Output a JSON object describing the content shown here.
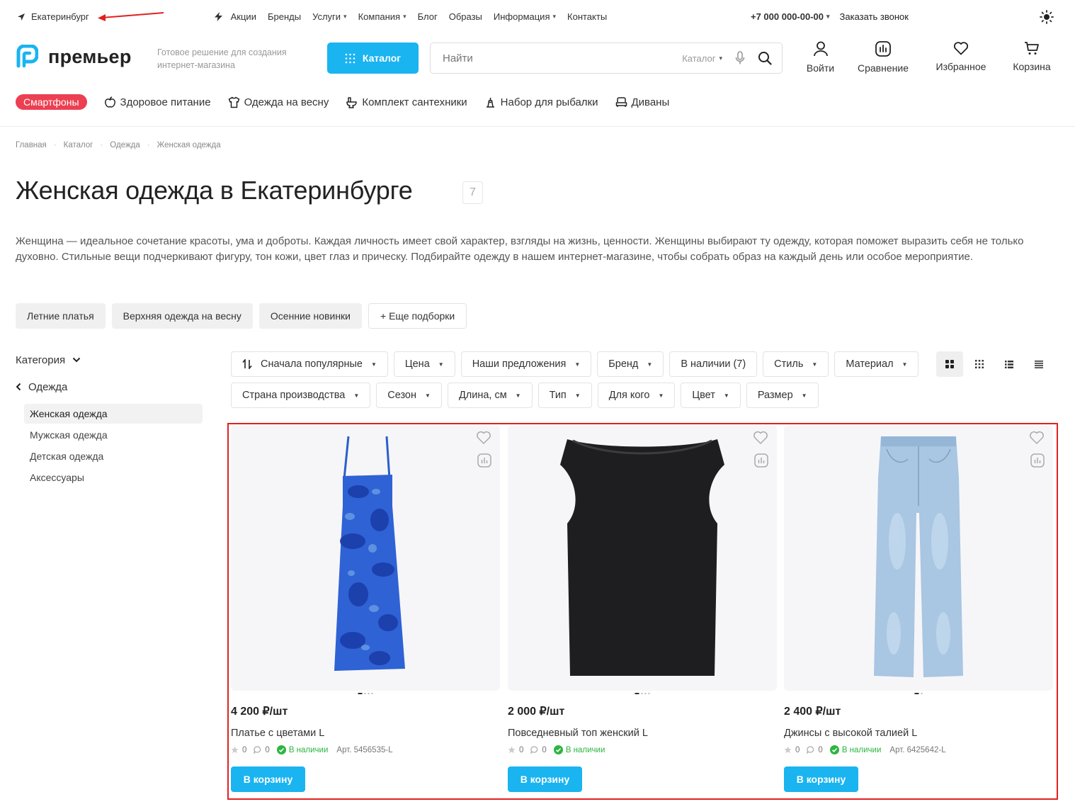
{
  "topbar": {
    "city": "Екатеринбург",
    "nav": [
      "Акции",
      "Бренды",
      "Услуги",
      "Компания",
      "Блог",
      "Образы",
      "Информация",
      "Контакты"
    ],
    "nav_dropdowns": [
      false,
      false,
      true,
      true,
      false,
      false,
      true,
      false
    ],
    "phone": "+7 000 000-00-00",
    "callback": "Заказать звонок"
  },
  "header": {
    "logo": "премьер",
    "slogan": "Готовое решение для создания интернет-магазина",
    "catalog_button": "Каталог",
    "search_placeholder": "Найти",
    "search_scope": "Каталог",
    "icons": [
      {
        "name": "login",
        "label": "Войти"
      },
      {
        "name": "compare",
        "label": "Сравнение"
      },
      {
        "name": "favorites",
        "label": "Избранное"
      },
      {
        "name": "cart",
        "label": "Корзина"
      }
    ]
  },
  "quick_links": {
    "badge": "Смартфоны",
    "items": [
      "Здоровое питание",
      "Одежда на весну",
      "Комплект сантехники",
      "Набор для рыбалки",
      "Диваны"
    ]
  },
  "breadcrumbs": [
    "Главная",
    "Каталог",
    "Одежда",
    "Женская одежда"
  ],
  "page": {
    "title": "Женская одежда в Екатеринбурге",
    "count": "7",
    "description": "Женщина — идеальное сочетание красоты, ума и доброты. Каждая личность имеет свой характер, взгляды на жизнь, ценности. Женщины выбирают ту одежду, которая поможет выразить себя не только духовно. Стильные вещи подчеркивают фигуру, тон кожи, цвет глаз и прическу. Подбирайте одежду в нашем интернет-магазине, чтобы собрать образ на каждый день или особое мероприятие."
  },
  "collections": [
    "Летние платья",
    "Верхняя одежда на весну",
    "Осенние новинки",
    "+ Еще подборки"
  ],
  "sidebar": {
    "heading": "Категория",
    "parent": "Одежда",
    "items": [
      "Женская одежда",
      "Мужская одежда",
      "Детская одежда",
      "Аксессуары"
    ],
    "active": 0
  },
  "filters": {
    "sort": "Сначала популярные",
    "items": [
      "Цена",
      "Наши предложения",
      "Бренд",
      "В наличии (7)",
      "Стиль",
      "Материал",
      "Страна производства",
      "Сезон",
      "Длина, см",
      "Тип",
      "Для кого",
      "Цвет",
      "Размер"
    ]
  },
  "products": [
    {
      "price": "4 200 ₽/шт",
      "name": "Платье с цветами L",
      "rating": "0",
      "reviews": "0",
      "stock": "В наличии",
      "sku": "Арт. 5456535-L",
      "button": "В корзину"
    },
    {
      "price": "2 000 ₽/шт",
      "name": "Повседневный топ женский L",
      "rating": "0",
      "reviews": "0",
      "stock": "В наличии",
      "sku": "",
      "button": "В корзину"
    },
    {
      "price": "2 400 ₽/шт",
      "name": "Джинсы с высокой талией L",
      "rating": "0",
      "reviews": "0",
      "stock": "В наличии",
      "sku": "Арт. 6425642-L",
      "button": "В корзину"
    }
  ],
  "colors": {
    "accent": "#1ab4f0",
    "badge": "#ec3f52",
    "stock": "#2db541",
    "highlight": "#e12121"
  }
}
